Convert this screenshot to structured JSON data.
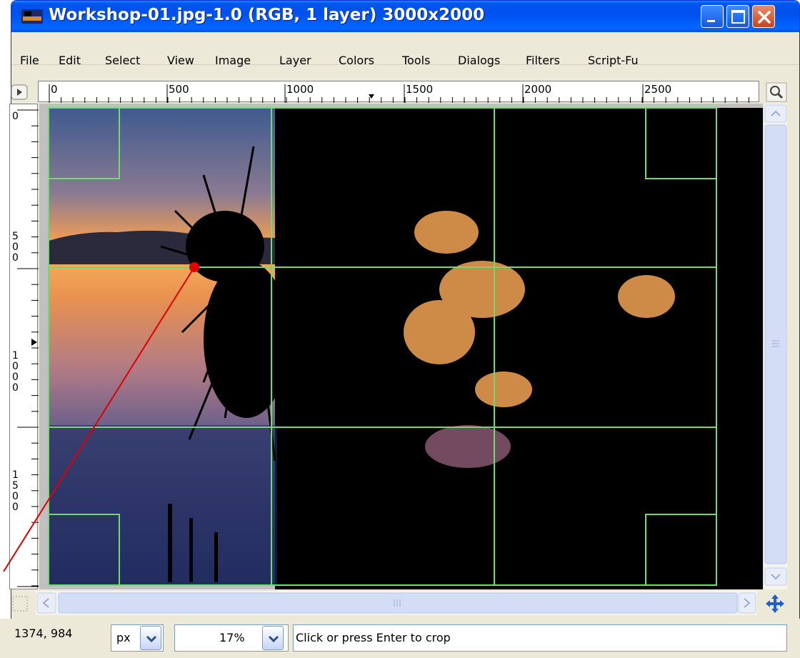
{
  "window": {
    "title": "Workshop-01.jpg-1.0 (RGB, 1 layer) 3000x2000"
  },
  "menu": {
    "items": [
      {
        "label": "File"
      },
      {
        "label": "Edit"
      },
      {
        "label": "Select"
      },
      {
        "label": "View"
      },
      {
        "label": "Image"
      },
      {
        "label": "Layer"
      },
      {
        "label": "Colors"
      },
      {
        "label": "Tools"
      },
      {
        "label": "Dialogs"
      },
      {
        "label": "Filters"
      },
      {
        "label": "Script-Fu"
      }
    ]
  },
  "hruler": {
    "labels": [
      "0",
      "500",
      "1000",
      "1500",
      "2000",
      "2500"
    ]
  },
  "vruler": {
    "labels": [
      "0",
      "500",
      "1000",
      "1500"
    ]
  },
  "statusbar": {
    "coords": "1374, 984",
    "unit": "px",
    "zoom": "17%",
    "message": "Click or press Enter to crop"
  },
  "colors": {
    "guide_green": "#6fdc6f",
    "annotation_red": "#e00000"
  }
}
